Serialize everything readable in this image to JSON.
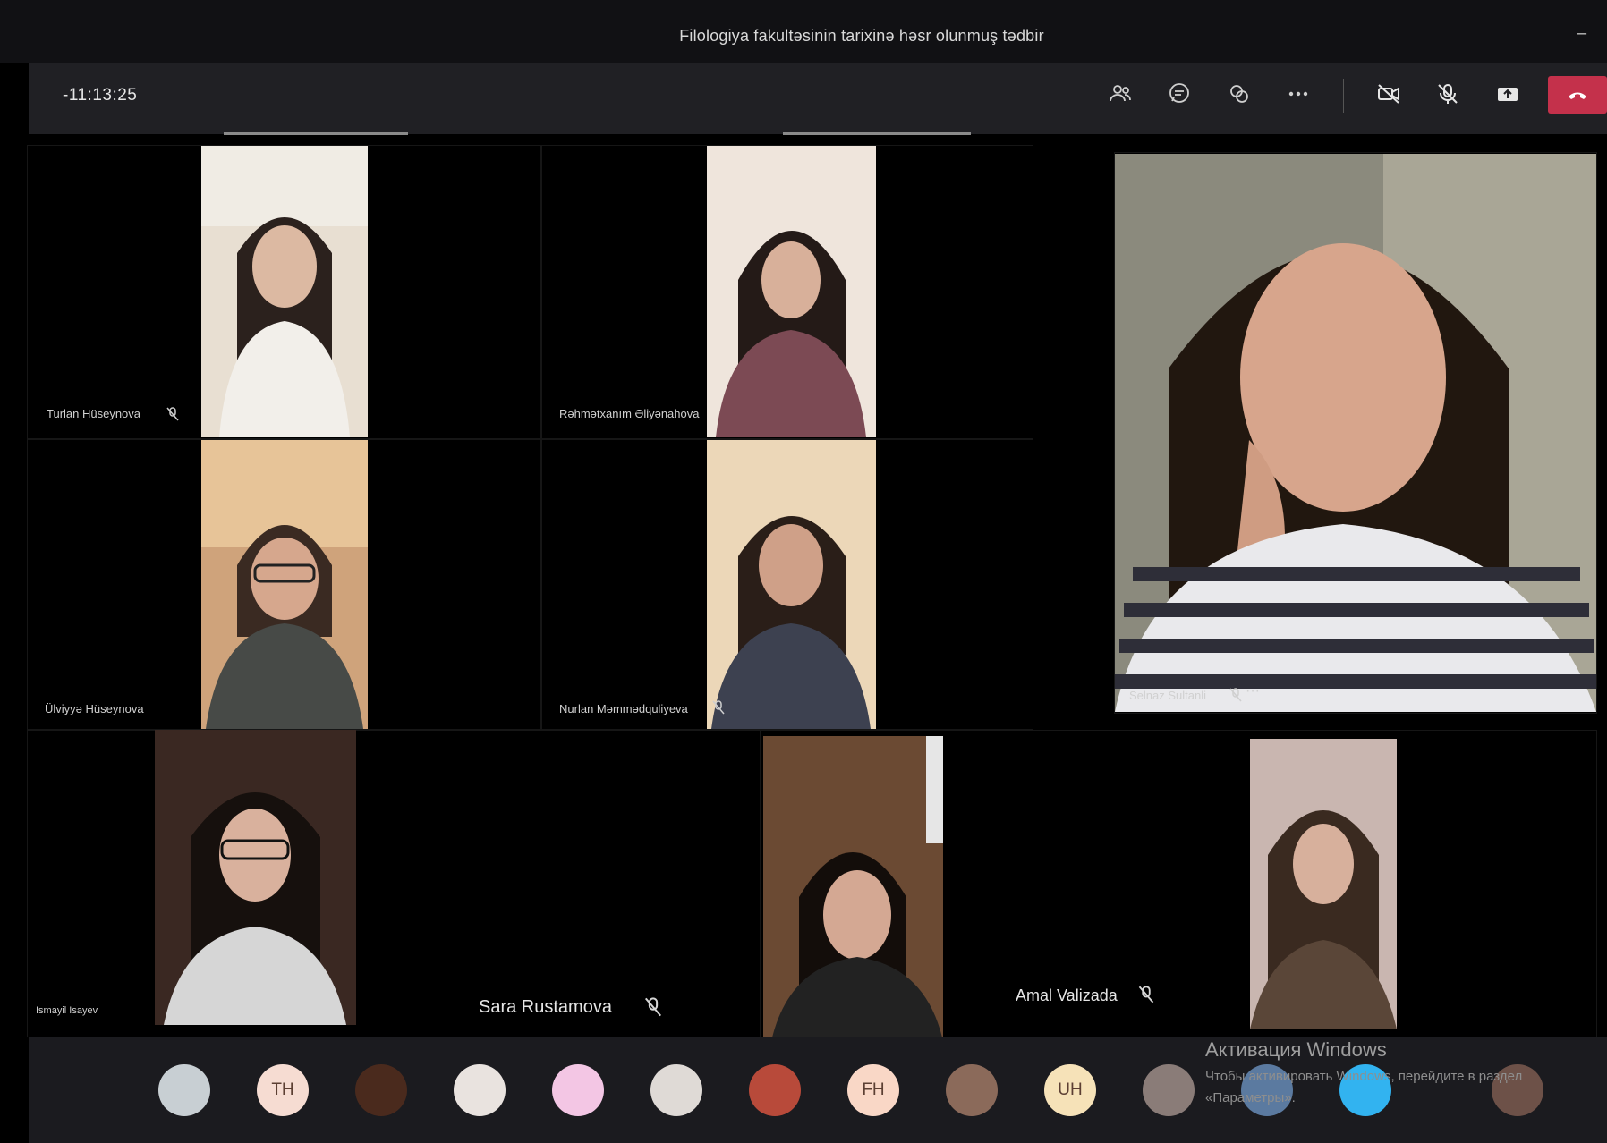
{
  "window": {
    "title": "Filologiya fakultəsinin tarixinə həsr olunmuş tədbir"
  },
  "controls": {
    "timer": "-11:13:25",
    "items": [
      "participants-icon",
      "chat-icon",
      "reactions-icon",
      "more-icon",
      "camera-off-icon",
      "mic-off-icon",
      "share-icon",
      "hangup-icon"
    ],
    "hangup_color": "#c4314b"
  },
  "participants": {
    "tiles": [
      {
        "name": "Turlan Hüseynova",
        "muted": true
      },
      {
        "name": "Rəhmətxanım Əliyənahova"
      },
      {
        "name": "Ülviyyə Hüseynova"
      },
      {
        "name": "Nurlan Məmmədquliyeva",
        "muted": true
      },
      {
        "name": "Selnaz Sultanli",
        "muted": true,
        "spotlight": true
      },
      {
        "name": "Ismayil Isayev",
        "muted": true
      },
      {
        "name": "Sara Rustamova",
        "muted": true
      },
      {
        "name": "Amal Valizada",
        "muted": true
      }
    ]
  },
  "tray": {
    "avatars": [
      {
        "initials": ""
      },
      {
        "initials": "TH"
      },
      {
        "initials": ""
      },
      {
        "initials": ""
      },
      {
        "initials": ""
      },
      {
        "initials": ""
      },
      {
        "initials": ""
      },
      {
        "initials": "FH"
      },
      {
        "initials": ""
      },
      {
        "initials": "UH"
      },
      {
        "initials": ""
      },
      {
        "initials": ""
      },
      {
        "initials": ""
      },
      {
        "initials": ""
      }
    ]
  },
  "watermark": {
    "title": "Активация Windows",
    "subtitle": "Чтобы активировать Windows, перейдите в раздел «Параметры»."
  }
}
